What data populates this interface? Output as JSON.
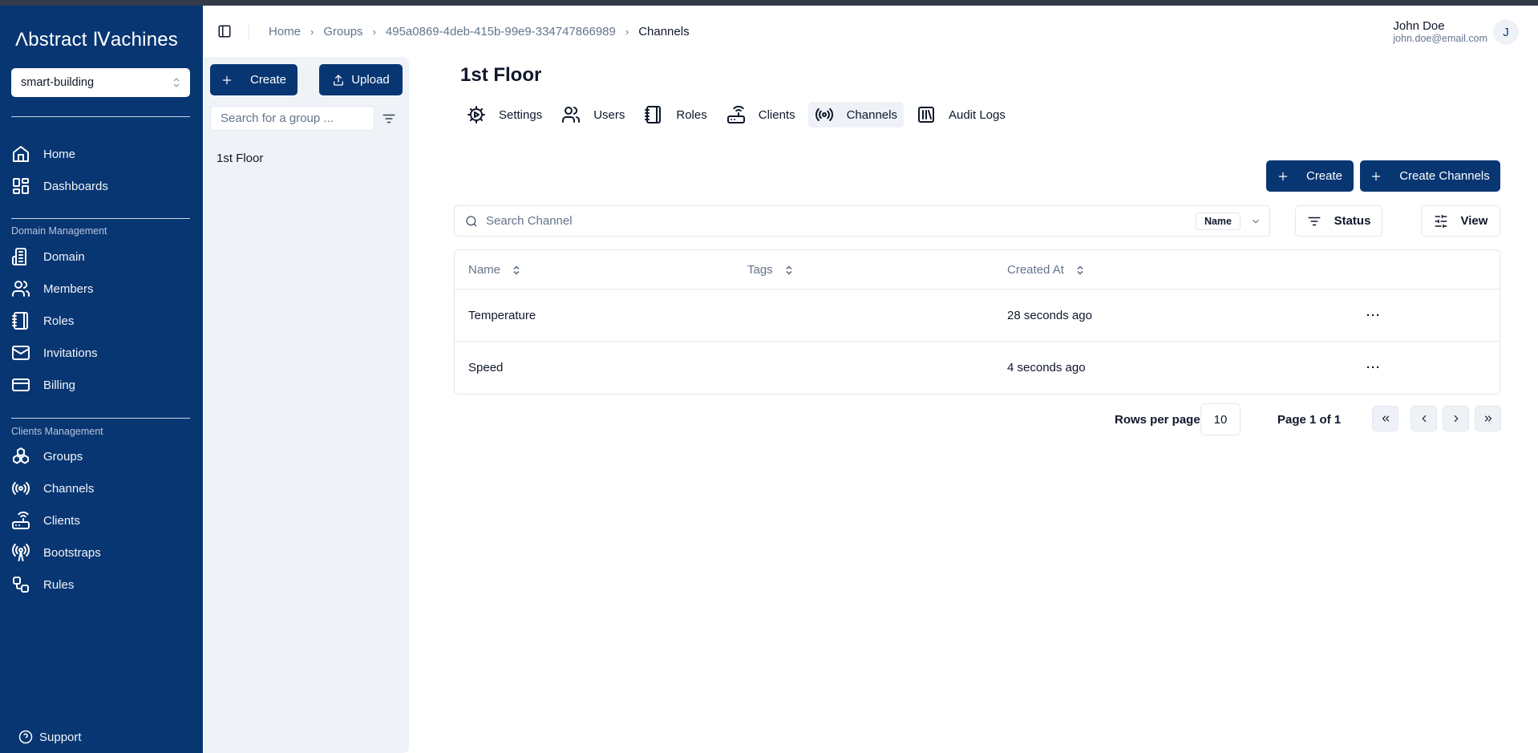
{
  "app": {
    "logo_text": "Λbstract Ⅳachines",
    "domain_selector": "smart-building"
  },
  "sidebar": {
    "top_items": [
      {
        "label": "Home",
        "icon": "home-icon"
      },
      {
        "label": "Dashboards",
        "icon": "dashboard-icon"
      }
    ],
    "domain_section": "Domain Management",
    "domain_items": [
      {
        "label": "Domain",
        "icon": "building-icon"
      },
      {
        "label": "Members",
        "icon": "users-icon"
      },
      {
        "label": "Roles",
        "icon": "notebook-icon"
      },
      {
        "label": "Invitations",
        "icon": "mail-icon"
      },
      {
        "label": "Billing",
        "icon": "credit-card-icon"
      }
    ],
    "clients_section": "Clients Management",
    "clients_items": [
      {
        "label": "Groups",
        "icon": "boxes-icon"
      },
      {
        "label": "Channels",
        "icon": "radio-icon"
      },
      {
        "label": "Clients",
        "icon": "router-icon"
      },
      {
        "label": "Bootstraps",
        "icon": "antenna-icon"
      },
      {
        "label": "Rules",
        "icon": "workflow-icon"
      }
    ],
    "support": "Support"
  },
  "header": {
    "breadcrumb": [
      "Home",
      "Groups",
      "495a0869-4deb-415b-99e9-334747866989",
      "Channels"
    ],
    "user_name": "John Doe",
    "user_email": "john.doe@email.com",
    "avatar_initial": "J"
  },
  "group_panel": {
    "create_label": "Create",
    "upload_label": "Upload",
    "search_placeholder": "Search for a group ...",
    "groups": [
      "1st Floor"
    ]
  },
  "main": {
    "title": "1st Floor",
    "tabs": [
      {
        "label": "Settings",
        "icon": "settings-icon",
        "active": false
      },
      {
        "label": "Users",
        "icon": "users-icon",
        "active": false
      },
      {
        "label": "Roles",
        "icon": "notebook-icon",
        "active": false
      },
      {
        "label": "Clients",
        "icon": "router-icon",
        "active": false
      },
      {
        "label": "Channels",
        "icon": "radio-icon",
        "active": true
      },
      {
        "label": "Audit Logs",
        "icon": "library-icon",
        "active": false
      }
    ],
    "create_label": "Create",
    "create_channels_label": "Create Channels",
    "search_placeholder": "Search Channel",
    "search_field": "Name",
    "status_label": "Status",
    "view_label": "View",
    "table": {
      "columns": [
        "Name",
        "Tags",
        "Created At"
      ],
      "rows": [
        {
          "name": "Temperature",
          "tags": "",
          "created_at": "28 seconds ago"
        },
        {
          "name": "Speed",
          "tags": "",
          "created_at": "4 seconds ago"
        }
      ],
      "actions_glyph": "···"
    },
    "pagination": {
      "rows_per_page_label": "Rows per page",
      "rows_per_page": "10",
      "page_info": "Page 1 of 1"
    }
  },
  "colors": {
    "brand": "#083672",
    "sidebar_bg": "#083672",
    "panel_bg": "#eff3f8"
  }
}
